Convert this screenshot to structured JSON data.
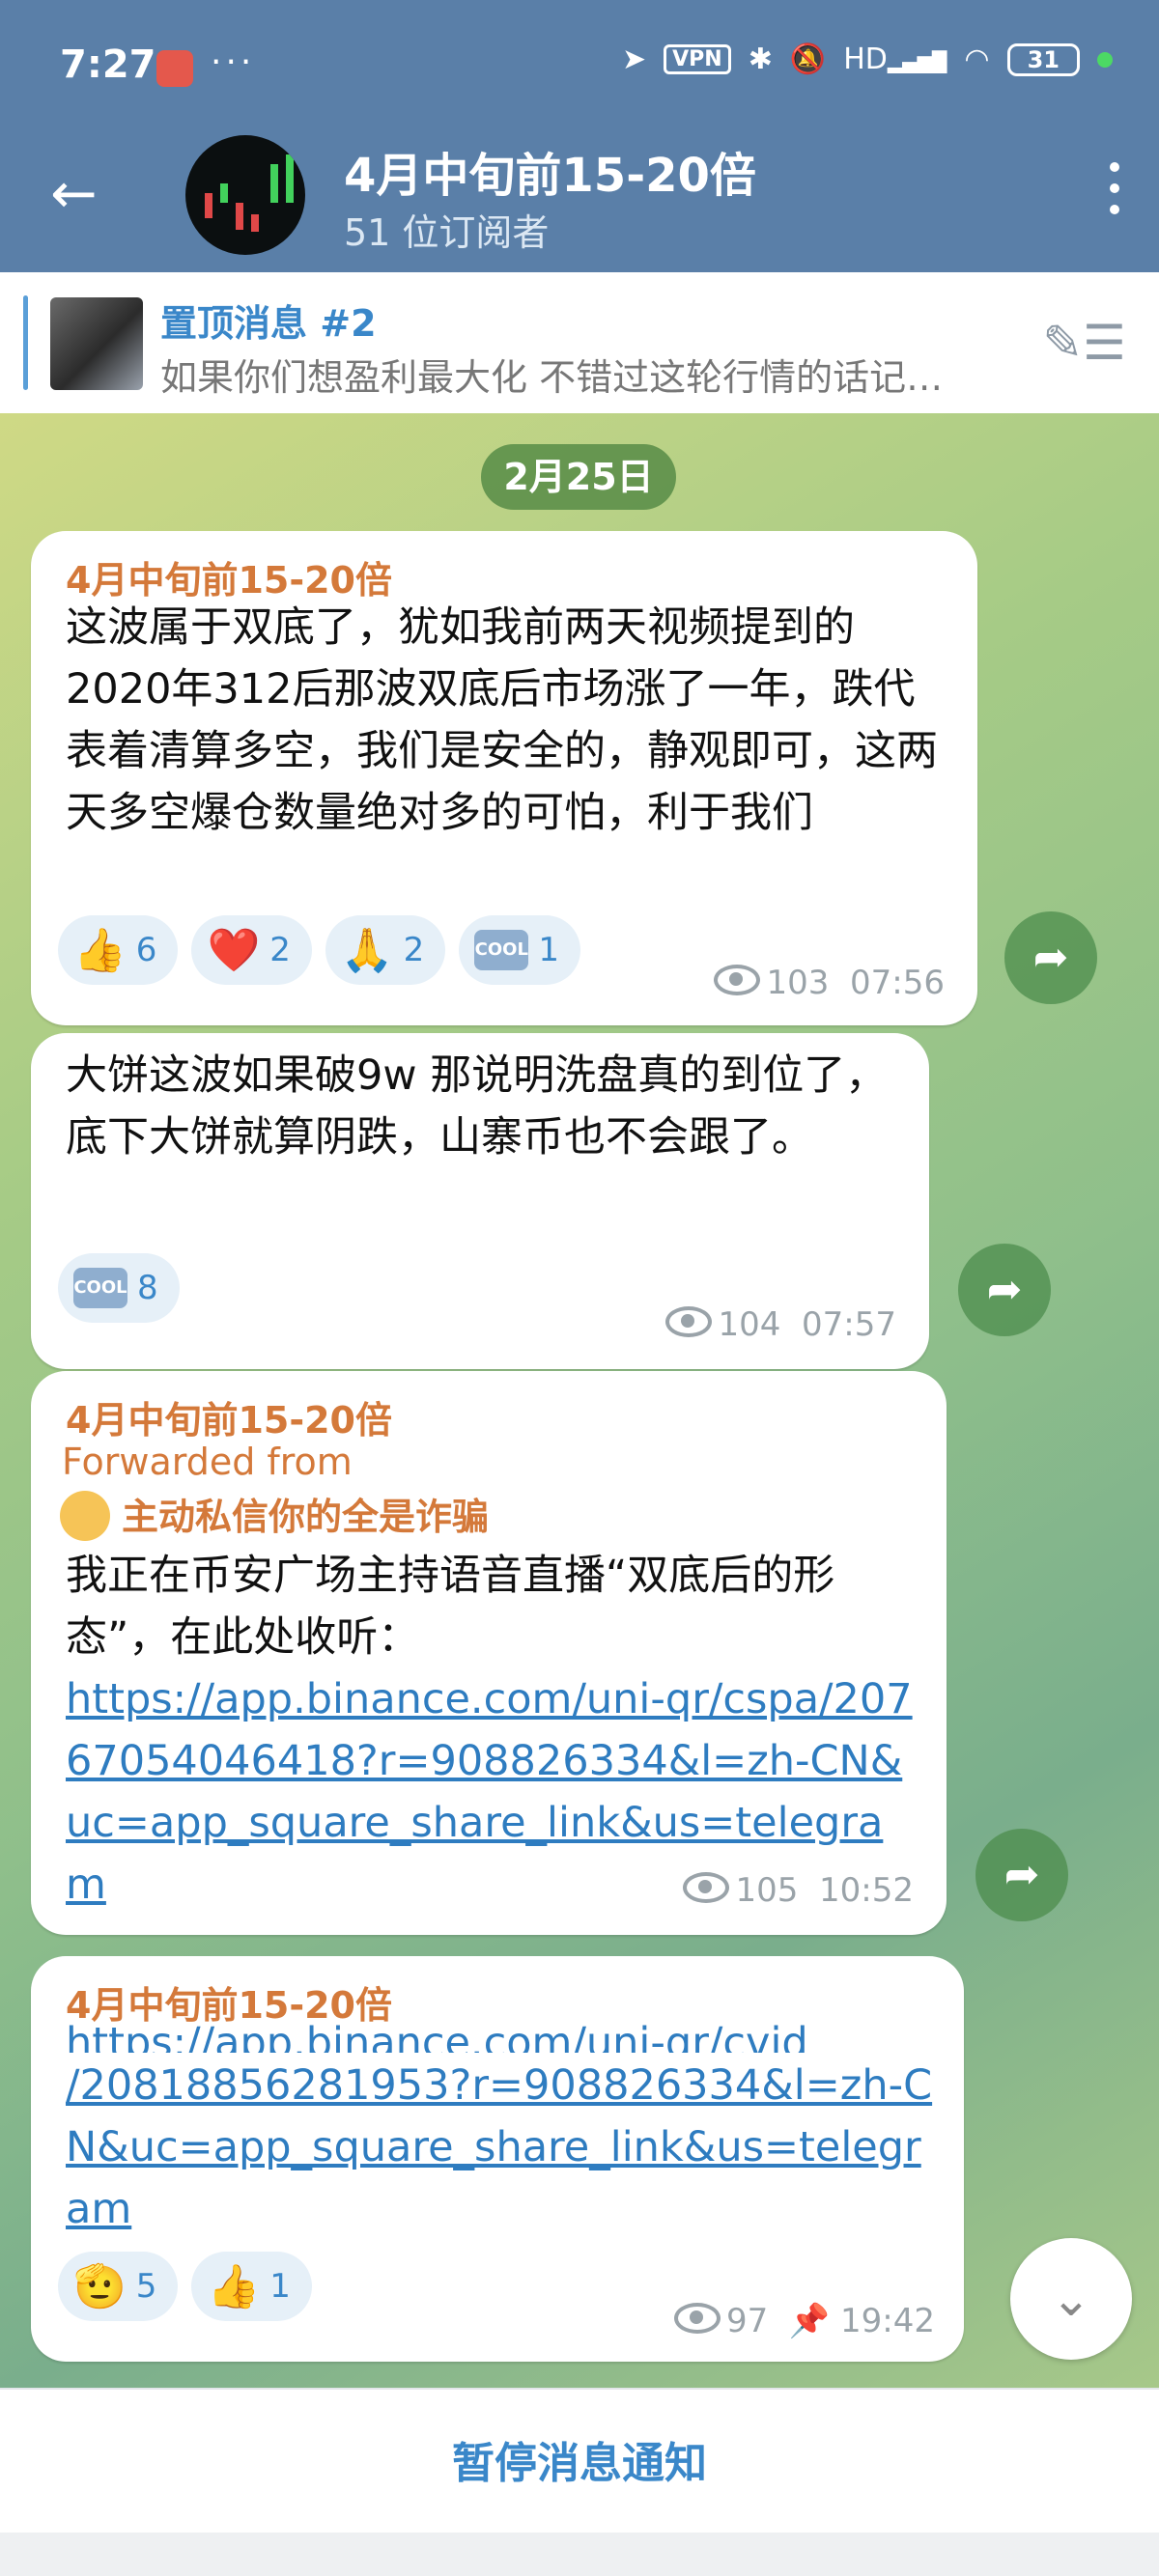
{
  "status_bar": {
    "time": "7:27",
    "dots": "···",
    "vpn": "VPN",
    "hd": "HD",
    "battery": "31"
  },
  "header": {
    "back_icon": "←",
    "title": "4月中旬前15-20倍",
    "subtitle": "51 位订阅者"
  },
  "pinned": {
    "title": "置顶消息 #2",
    "text": "如果你们想盈利最大化 不错过这轮行情的话记…"
  },
  "chat": {
    "date": "2月25日",
    "messages": [
      {
        "sender": "4月中旬前15-20倍",
        "text": "这波属于双底了，犹如我前两天视频提到的2020年312后那波双底后市场涨了一年，跌代表着清算多空，我们是安全的，静观即可，这两天多空爆仓数量绝对多的可怕，利于我们",
        "reactions": [
          {
            "emoji": "👍",
            "count": "6"
          },
          {
            "emoji": "❤️",
            "count": "2"
          },
          {
            "emoji": "🙏",
            "count": "2"
          },
          {
            "emoji": "COOL",
            "count": "1"
          }
        ],
        "views": "103",
        "time": "07:56"
      },
      {
        "text": "大饼这波如果破9w 那说明洗盘真的到位了，底下大饼就算阴跌，山寨币也不会跟了。",
        "reactions": [
          {
            "emoji": "COOL",
            "count": "8"
          }
        ],
        "views": "104",
        "time": "07:57"
      },
      {
        "sender": "4月中旬前15-20倍",
        "forwarded_label": "Forwarded from",
        "forwarded_name": "主动私信你的全是诈骗",
        "text": "我正在币安广场主持语音直播“双底后的形态”，在此处收听：",
        "link": "https://app.binance.com/uni-qr/cspa/20767054046418?r=908826334&l=zh-CN&uc=app_square_share_link&us=telegram",
        "views": "105",
        "time": "10:52"
      },
      {
        "sender": "4月中旬前15-20倍",
        "link_partial": "https://app.binance.com/uni-qr/cvid",
        "link": "/20818856281953?r=908826334&l=zh-CN&uc=app_square_share_link&us=telegram",
        "reactions": [
          {
            "emoji": "🫡",
            "count": "5"
          },
          {
            "emoji": "👍",
            "count": "1"
          }
        ],
        "views": "97",
        "time": "19:42"
      }
    ]
  },
  "bottom": {
    "mute_label": "暂停消息通知"
  }
}
